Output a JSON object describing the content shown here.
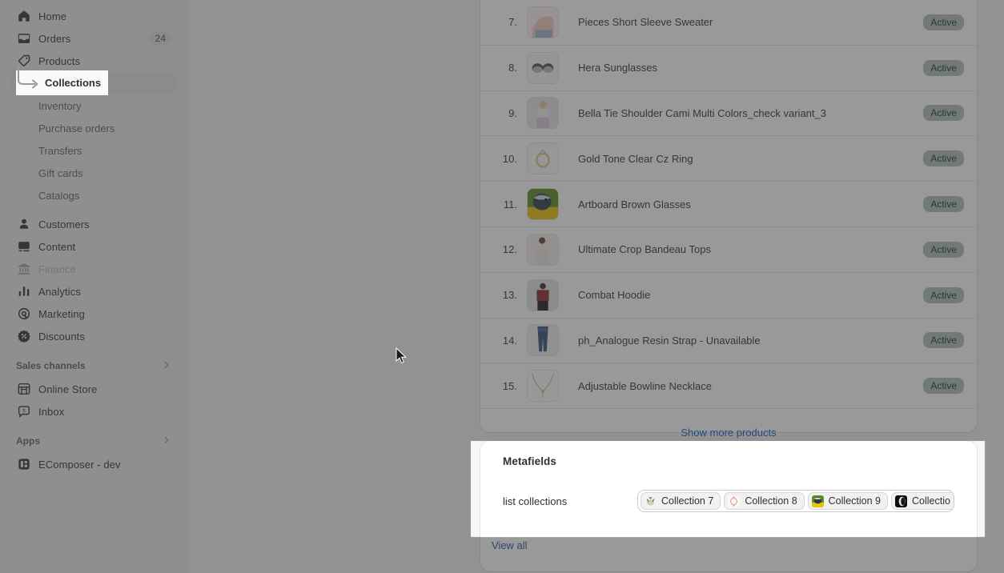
{
  "sidebar": {
    "items": [
      {
        "label": "Home",
        "icon": "home-icon",
        "badge": null,
        "disabled": false
      },
      {
        "label": "Orders",
        "icon": "orders-icon",
        "badge": "24",
        "disabled": false
      },
      {
        "label": "Products",
        "icon": "tag-icon",
        "badge": null,
        "disabled": false
      }
    ],
    "product_subitems": [
      {
        "label": "Collections",
        "active": true
      },
      {
        "label": "Inventory",
        "active": false
      },
      {
        "label": "Purchase orders",
        "active": false
      },
      {
        "label": "Transfers",
        "active": false
      },
      {
        "label": "Gift cards",
        "active": false
      },
      {
        "label": "Catalogs",
        "active": false
      }
    ],
    "items_after": [
      {
        "label": "Customers",
        "icon": "customer-icon",
        "disabled": false
      },
      {
        "label": "Content",
        "icon": "content-icon",
        "disabled": false
      },
      {
        "label": "Finance",
        "icon": "finance-icon",
        "disabled": true
      },
      {
        "label": "Analytics",
        "icon": "analytics-icon",
        "disabled": false
      },
      {
        "label": "Marketing",
        "icon": "marketing-icon",
        "disabled": false
      },
      {
        "label": "Discounts",
        "icon": "discount-icon",
        "disabled": false
      }
    ],
    "sales_channels": {
      "header": "Sales channels",
      "chevron": "chevron-right-icon",
      "items": [
        {
          "label": "Online Store",
          "icon": "store-icon"
        },
        {
          "label": "Inbox",
          "icon": "inbox-icon"
        }
      ]
    },
    "apps": {
      "header": "Apps",
      "chevron": "chevron-right-icon",
      "items": [
        {
          "label": "EComposer - dev",
          "icon": "app-icon"
        }
      ]
    }
  },
  "products_card": {
    "rows": [
      {
        "index": "7.",
        "title": "Pieces Short Sleeve Sweater",
        "status": "Active",
        "thumb": "sweater"
      },
      {
        "index": "8.",
        "title": "Hera Sunglasses",
        "status": "Active",
        "thumb": "sunglasses"
      },
      {
        "index": "9.",
        "title": "Bella Tie Shoulder Cami Multi Colors_check variant_3",
        "status": "Active",
        "thumb": "cami"
      },
      {
        "index": "10.",
        "title": "Gold Tone Clear Cz Ring",
        "status": "Active",
        "thumb": "ring"
      },
      {
        "index": "11.",
        "title": "Artboard Brown Glasses",
        "status": "Active",
        "thumb": "bird"
      },
      {
        "index": "12.",
        "title": "Ultimate Crop Bandeau Tops",
        "status": "Active",
        "thumb": "croptop"
      },
      {
        "index": "13.",
        "title": "Combat Hoodie",
        "status": "Active",
        "thumb": "hoodie"
      },
      {
        "index": "14.",
        "title": "ph_Analogue Resin Strap - Unavailable",
        "status": "Active",
        "thumb": "jeans"
      },
      {
        "index": "15.",
        "title": "Adjustable Bowline Necklace",
        "status": "Active",
        "thumb": "necklace"
      }
    ],
    "show_more_label": "Show more products"
  },
  "metafields": {
    "title": "Metafields",
    "field_label": "list collections",
    "chips": [
      {
        "label": "Collection 7",
        "thumb": "cat"
      },
      {
        "label": "Collection 8",
        "thumb": "watch"
      },
      {
        "label": "Collection 9",
        "thumb": "bird"
      },
      {
        "label": "Collectio",
        "thumb": "dark"
      }
    ],
    "view_all_label": "View all"
  },
  "colors": {
    "accent_link": "#005bd3",
    "status_green_bg": "#afbeb3",
    "status_green_text": "#0c3b23",
    "sidebar_bg": "#ebebeb",
    "page_bg": "#f1f1f1",
    "view_all_link": "#1f4d9e"
  }
}
